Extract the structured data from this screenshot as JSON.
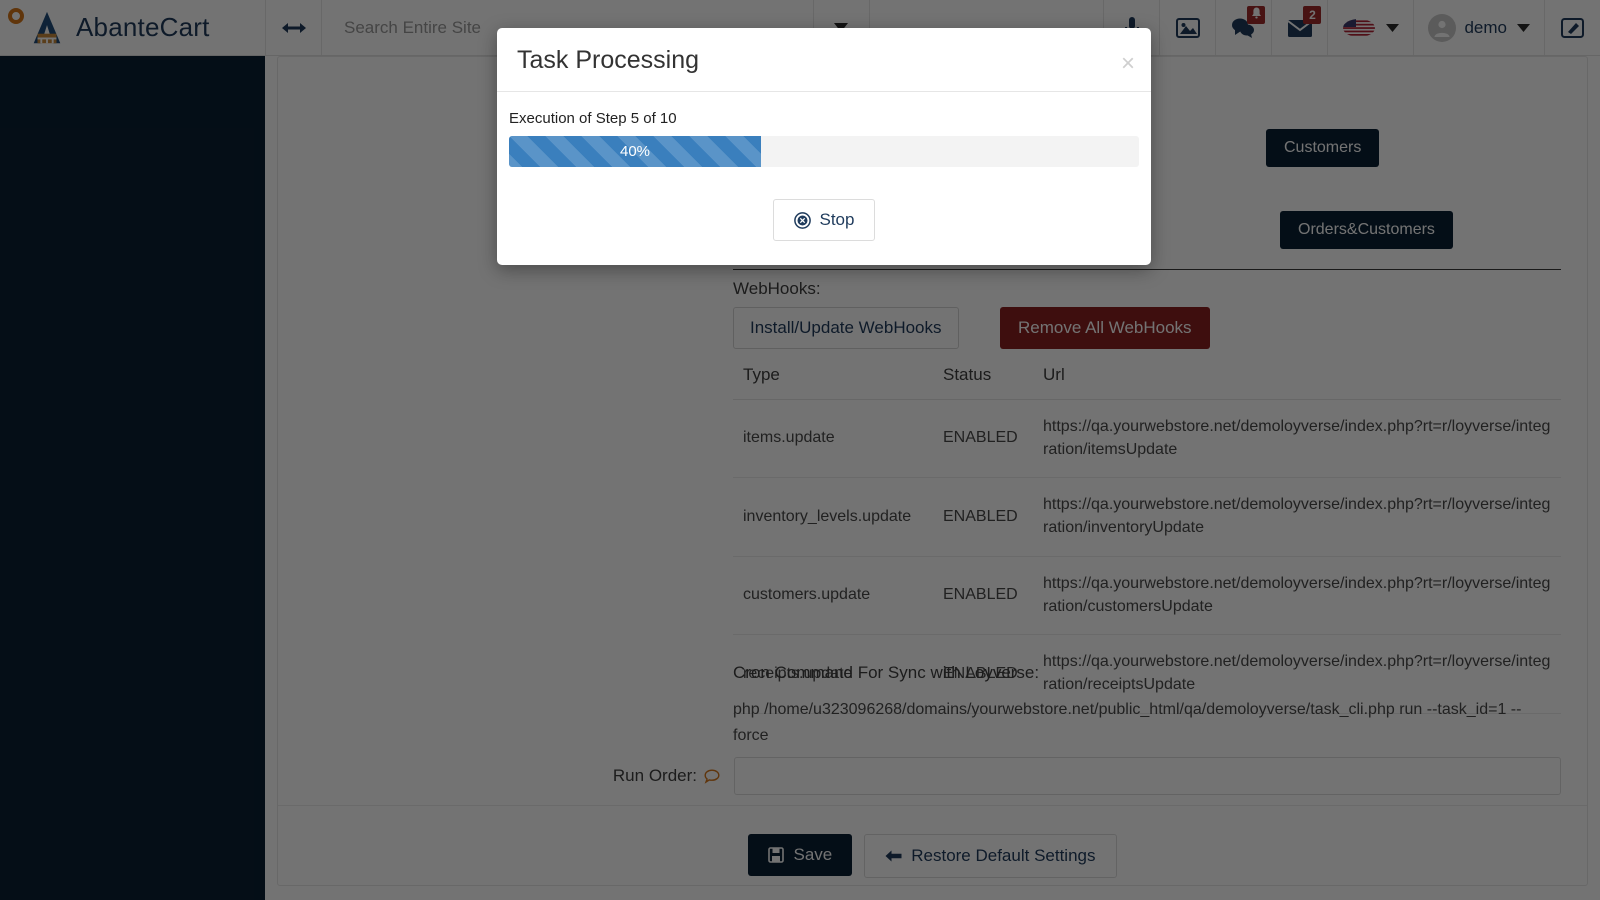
{
  "header": {
    "brand": "AbanteCart",
    "expand_icon": "expand-arrows-icon",
    "search_placeholder": "Search Entire Site",
    "search_value": "",
    "caret_icon": "chevron-down-icon",
    "mic_icon": "microphone-icon",
    "media_icon": "image-icon",
    "chat_icon": "chat-bell-icon",
    "mail_icon": "envelope-icon",
    "mail_badge": "2",
    "flag_icon": "us-flag-icon",
    "flag_caret_icon": "chevron-down-icon",
    "avatar_icon": "user-avatar-icon",
    "user_name": "demo",
    "user_caret_icon": "chevron-down-icon",
    "edit_icon": "edit-square-icon"
  },
  "actions": {
    "customers": "Customers",
    "orders_customers": "Orders&Customers"
  },
  "webhooks": {
    "label": "WebHooks:",
    "install_button": "Install/Update WebHooks",
    "remove_button": "Remove All WebHooks",
    "columns": [
      "Type",
      "Status",
      "Url"
    ],
    "rows": [
      {
        "type": "items.update",
        "status": "ENABLED",
        "url": "https://qa.yourwebstore.net/demoloyverse/index.php?rt=r/loyverse/integration/itemsUpdate"
      },
      {
        "type": "inventory_levels.update",
        "status": "ENABLED",
        "url": "https://qa.yourwebstore.net/demoloyverse/index.php?rt=r/loyverse/integration/inventoryUpdate"
      },
      {
        "type": "customers.update",
        "status": "ENABLED",
        "url": "https://qa.yourwebstore.net/demoloyverse/index.php?rt=r/loyverse/integration/customersUpdate"
      },
      {
        "type": "receipts.update",
        "status": "ENABLED",
        "url": "https://qa.yourwebstore.net/demoloyverse/index.php?rt=r/loyverse/integration/receiptsUpdate"
      }
    ]
  },
  "cron": {
    "label": "Cron Command For Sync with Loyverse:",
    "command": "php /home/u323096268/domains/yourwebstore.net/public_html/qa/demoloyverse/task_cli.php run --task_id=1 --force"
  },
  "run_order": {
    "label": "Run Order:",
    "tooltip_icon": "speech-bubble-icon",
    "value": "",
    "placeholder": ""
  },
  "footer": {
    "save_label": "Save",
    "save_icon": "floppy-disk-icon",
    "restore_label": "Restore Default Settings",
    "restore_icon": "arrow-left-icon"
  },
  "modal": {
    "title": "Task Processing",
    "close_icon": "close-icon",
    "close_glyph": "×",
    "execution_text": "Execution of Step 5 of 10",
    "progress_percent_label": "40%",
    "progress_percent": 40,
    "current_step": 5,
    "total_steps": 10,
    "stop_label": "Stop",
    "stop_icon": "circle-x-icon",
    "progress_color": "#3a7fbd"
  }
}
